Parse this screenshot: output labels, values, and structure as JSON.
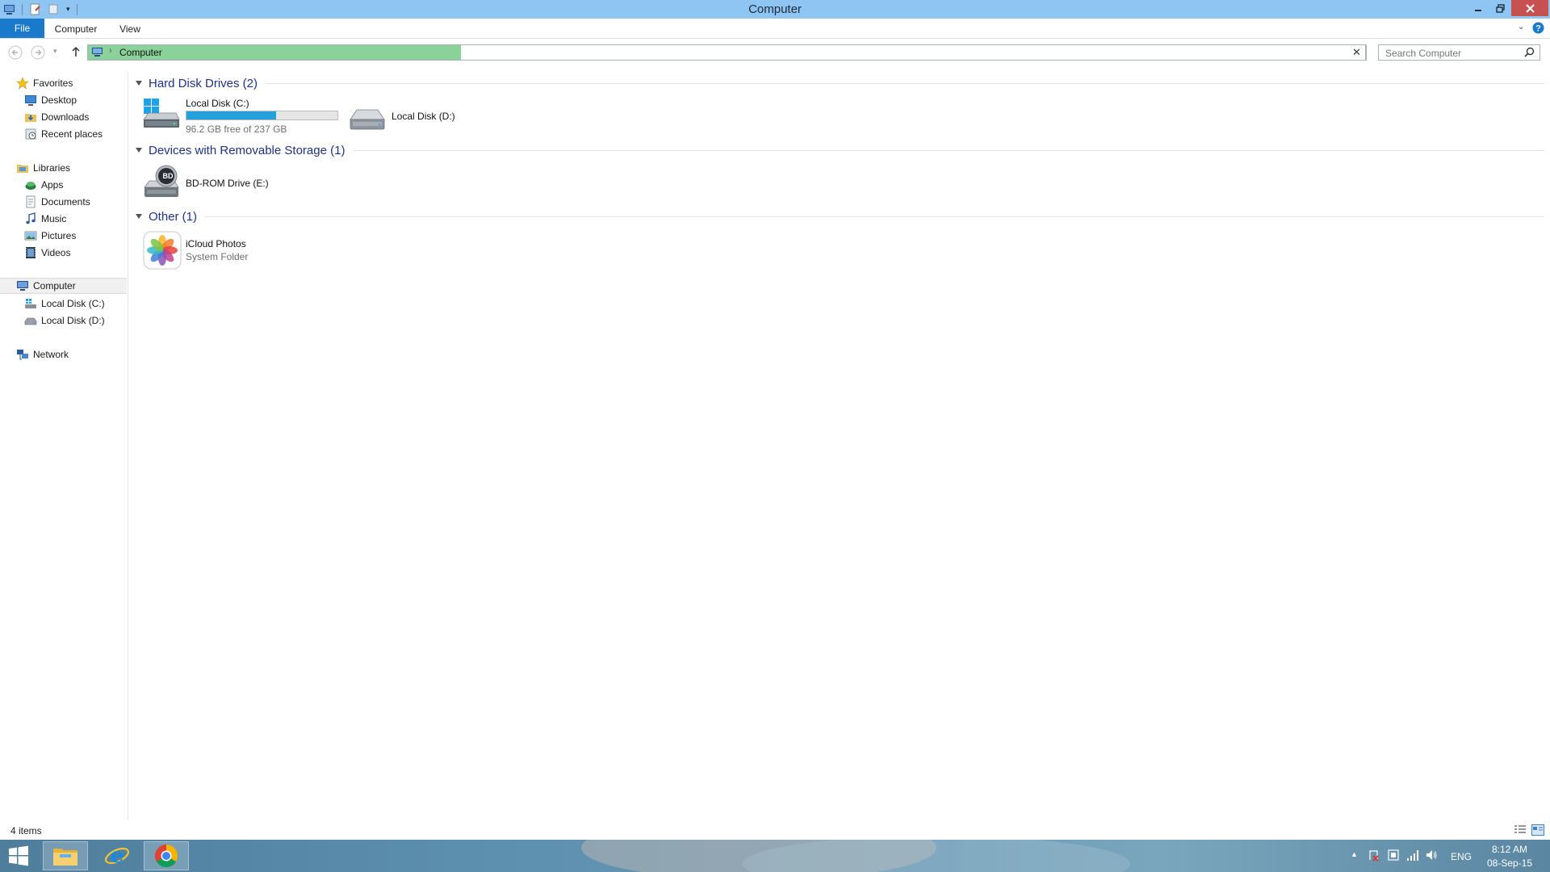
{
  "window": {
    "title": "Computer"
  },
  "ribbon": {
    "tabs": [
      "File",
      "Computer",
      "View"
    ]
  },
  "address": {
    "location": "Computer"
  },
  "search": {
    "placeholder": "Search Computer"
  },
  "nav": {
    "favorites": {
      "label": "Favorites",
      "items": [
        "Desktop",
        "Downloads",
        "Recent places"
      ]
    },
    "libraries": {
      "label": "Libraries",
      "items": [
        "Apps",
        "Documents",
        "Music",
        "Pictures",
        "Videos"
      ]
    },
    "computer": {
      "label": "Computer",
      "items": [
        "Local Disk (C:)",
        "Local Disk (D:)"
      ]
    },
    "network": {
      "label": "Network"
    }
  },
  "groups": {
    "hdd": {
      "title": "Hard Disk Drives (2)",
      "c": {
        "name": "Local Disk (C:)",
        "free": "96.2 GB free of 237 GB",
        "used_fraction": 0.594
      },
      "d": {
        "name": "Local Disk (D:)"
      }
    },
    "removable": {
      "title": "Devices with Removable Storage (1)",
      "bd": {
        "name": "BD-ROM Drive (E:)",
        "badge": "BD"
      }
    },
    "other": {
      "title": "Other (1)",
      "icloud": {
        "name": "iCloud Photos",
        "type": "System Folder"
      }
    }
  },
  "status": {
    "items": "4 items"
  },
  "tray": {
    "lang": "ENG",
    "time": "8:12 AM",
    "date": "08-Sep-15"
  },
  "colors": {
    "titlebar": "#8ec5f2",
    "file_tab": "#1979ca",
    "address_progress": "#8ad29a",
    "drive_bar": "#26a0da",
    "group_title": "#1e3287"
  },
  "icons": [
    "computer-icon",
    "save-icon",
    "undo-icon",
    "star-icon",
    "desktop-icon",
    "downloads-icon",
    "recent-places-icon",
    "libraries-icon",
    "apps-icon",
    "documents-icon",
    "music-icon",
    "pictures-icon",
    "videos-icon",
    "drive-icon",
    "network-icon",
    "search-icon",
    "windows-icon",
    "explorer-icon",
    "ie-icon",
    "chrome-icon"
  ]
}
